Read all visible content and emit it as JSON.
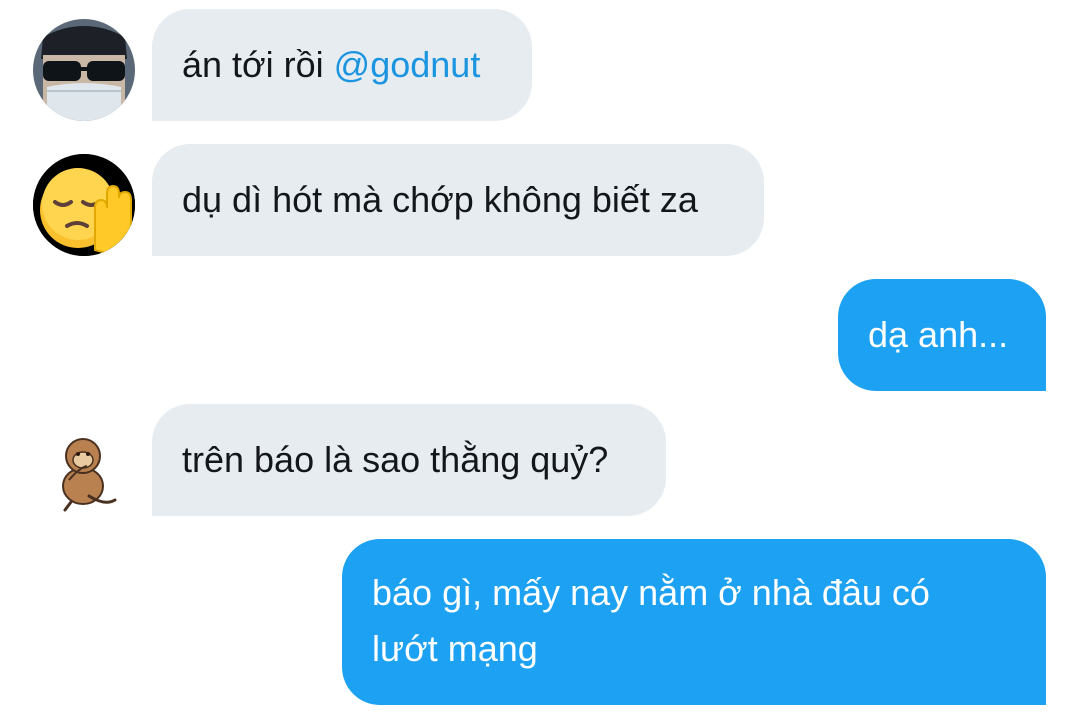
{
  "conversation": {
    "messages": [
      {
        "direction": "incoming",
        "avatar_icon": "sunglasses-masked-man-avatar",
        "text": "án tới rồi ",
        "mention": "@godnut"
      },
      {
        "direction": "incoming",
        "avatar_icon": "pensive-face-emoji-avatar",
        "text": "dụ dì hót mà chớp không biết za"
      },
      {
        "direction": "outgoing",
        "text": "dạ anh..."
      },
      {
        "direction": "incoming",
        "avatar_icon": "monkey-sticker-avatar",
        "text": "trên báo là sao thằng quỷ?"
      },
      {
        "direction": "outgoing",
        "lines": [
          "báo gì, mấy nay nằm ở nhà đâu có",
          "lướt mạng"
        ]
      }
    ]
  },
  "colors": {
    "incoming_bubble": "#e6ecf0",
    "outgoing_bubble": "#1da1f2",
    "mention": "#1b95e0",
    "text_dark": "#14171a",
    "text_light": "#ffffff"
  }
}
